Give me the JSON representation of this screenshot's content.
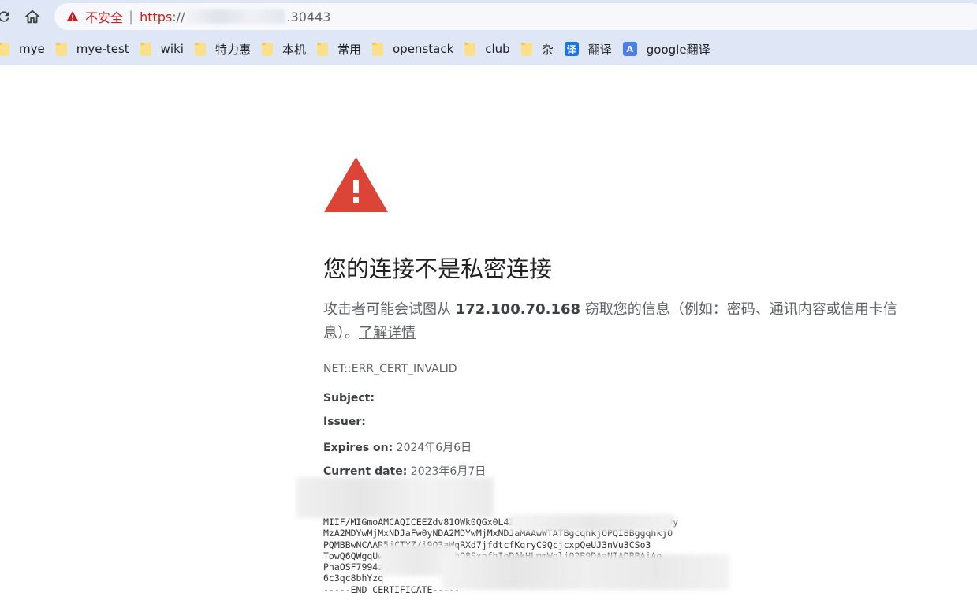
{
  "topbar": {
    "omnibox": {
      "security_label": "不安全",
      "separator": "|",
      "url_scheme": "https",
      "url_slash": "://",
      "url_port": ".30443"
    }
  },
  "bookmarks": [
    {
      "label": "mye",
      "icon": "folder-icon"
    },
    {
      "label": "mye-test",
      "icon": "folder-icon"
    },
    {
      "label": "wiki",
      "icon": "folder-icon"
    },
    {
      "label": "特力惠",
      "icon": "folder-icon"
    },
    {
      "label": "本机",
      "icon": "folder-icon"
    },
    {
      "label": "常用",
      "icon": "folder-icon"
    },
    {
      "label": "openstack",
      "icon": "folder-icon"
    },
    {
      "label": "club",
      "icon": "folder-icon"
    },
    {
      "label": "杂",
      "icon": "folder-icon"
    },
    {
      "label": "翻译",
      "icon": "translate-icon",
      "icon_glyph": "译"
    },
    {
      "label": "google翻译",
      "icon": "google-translate-icon",
      "icon_glyph": "A"
    }
  ],
  "interstitial": {
    "heading": "您的连接不是私密连接",
    "explanation_before": "攻击者可能会试图从 ",
    "host": "172.100.70.168",
    "explanation_after": " 窃取您的信息（例如：密码、通讯内容或信用卡信息）。",
    "learn_more": "了解详情",
    "error_code": "NET::ERR_CERT_INVALID",
    "details": {
      "subject_label": "Subject:",
      "subject_value": "",
      "issuer_label": "Issuer:",
      "issuer_value": "",
      "expires_label": "Expires on:",
      "expires_value": "2024年6月6日",
      "current_label": "Current date:",
      "current_value": "2023年6月7日"
    },
    "certificate_text": "MIIF/MIGmoAMCAQICEEZdv81OWk0QGx0L4ZMmE2UwCgYIKoZIzj0EAwIwADAeFw0y\nMzA2MDYwMjMxNDJaFw0yNDA2MDYwMjMxNDJaMAAwWTATBgcqhkjOPQIBBggqhkjO\nPQMBBwNCAAR5jCTYZ/i9Q3aWqRXd7jfdtcfKqryC9QcjcxpQeUJ3nVu3CSo3\nTowQ6QWgqUw0JXMpB6FcCDa7hQ8SxnfhIoDAkHLmmWoljQ2B9DAaNIADBBAiAo\nPnaOSF7994zDSxK1mYqb3eSzgMx0UkCf5jEn9yQ0IhNvAiB0l2kT9wRgY1\n6c3qc8bhYzq\n-----END CERTIFICATE-----"
  },
  "colors": {
    "danger": "#db4437",
    "security_red": "#c5221f",
    "chrome_frame": "#dfe7f6",
    "omnibox_bg": "#f6f8fc"
  }
}
